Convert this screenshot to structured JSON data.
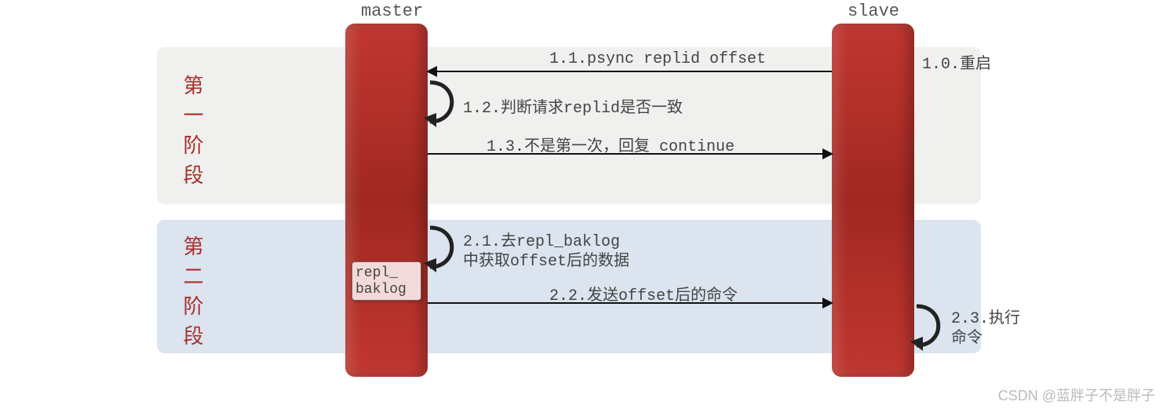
{
  "participants": {
    "master": "master",
    "slave": "slave"
  },
  "phase1": {
    "label": "第一阶段"
  },
  "phase2": {
    "label": "第二阶段"
  },
  "messages": {
    "m10": "1.0.重启",
    "m11": "1.1.psync replid offset",
    "m12": "1.2.判断请求replid是否一致",
    "m13": "1.3.不是第一次，回复 continue",
    "m21a": "2.1.去repl_baklog",
    "m21b": "中获取offset后的数据",
    "m22": "2.2.发送offset后的命令",
    "m23a": "2.3.执行",
    "m23b": "命令"
  },
  "artifacts": {
    "repl_baklog": "repl_ baklog"
  },
  "watermark": "CSDN @蓝胖子不是胖子"
}
